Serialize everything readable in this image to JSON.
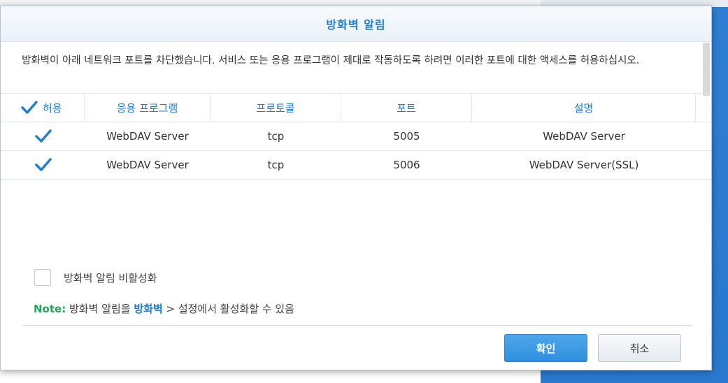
{
  "dialog": {
    "title": "방화벽 알림",
    "description": "방화벽이 아래 네트워크 포트를 차단했습니다. 서비스 또는 응용 프로그램이 제대로 작동하도록 하려면 이러한 포트에 대한 액세스를 허용하십시오."
  },
  "table": {
    "headers": {
      "allow": "허용",
      "application": "응용 프로그램",
      "protocol": "프로토콜",
      "port": "포트",
      "description": "설명"
    },
    "header_checked": true,
    "rows": [
      {
        "checked": true,
        "application": "WebDAV Server",
        "protocol": "tcp",
        "port": "5005",
        "description": "WebDAV Server"
      },
      {
        "checked": true,
        "application": "WebDAV Server",
        "protocol": "tcp",
        "port": "5006",
        "description": "WebDAV Server(SSL)"
      }
    ]
  },
  "disable_option": {
    "label": "방화벽 알림 비활성화",
    "checked": false
  },
  "note": {
    "key": "Note:",
    "text_before": " 방화벽 알림을 ",
    "link": "방화벽",
    "text_after": " > 설정에서 활성화할 수 있음"
  },
  "buttons": {
    "ok": "확인",
    "cancel": "취소"
  },
  "colors": {
    "accent": "#1f7dd4",
    "note_green": "#22a65a",
    "desktop_blue": "#2e7fd4"
  }
}
